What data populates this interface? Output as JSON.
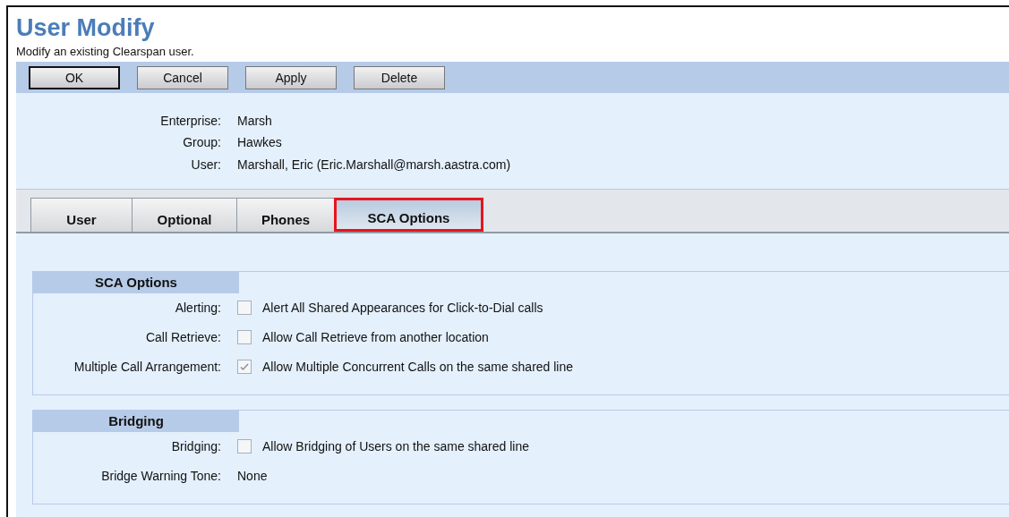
{
  "page": {
    "title": "User Modify",
    "subtitle": "Modify an existing Clearspan user."
  },
  "buttons": [
    {
      "label": "OK",
      "default": true
    },
    {
      "label": "Cancel",
      "default": false
    },
    {
      "label": "Apply",
      "default": false
    },
    {
      "label": "Delete",
      "default": false
    }
  ],
  "info": [
    {
      "label": "Enterprise:",
      "value": "Marsh"
    },
    {
      "label": "Group:",
      "value": "Hawkes"
    },
    {
      "label": "User:",
      "value": "Marshall, Eric (Eric.Marshall@marsh.aastra.com)"
    }
  ],
  "tabs": [
    {
      "label": "User",
      "selected": false
    },
    {
      "label": "Optional",
      "selected": false
    },
    {
      "label": "Phones",
      "selected": false
    },
    {
      "label": "SCA Options",
      "selected": true
    }
  ],
  "sections": [
    {
      "title": "SCA Options",
      "rows": [
        {
          "kind": "checkbox",
          "label": "Alerting:",
          "text": "Alert All Shared Appearances for Click-to-Dial calls",
          "checked": false
        },
        {
          "kind": "checkbox",
          "label": "Call Retrieve:",
          "text": "Allow Call Retrieve from another location",
          "checked": false
        },
        {
          "kind": "checkbox",
          "label": "Multiple Call Arrangement:",
          "text": "Allow Multiple Concurrent Calls on the same shared line",
          "checked": true
        }
      ]
    },
    {
      "title": "Bridging",
      "rows": [
        {
          "kind": "checkbox",
          "label": "Bridging:",
          "text": "Allow Bridging of Users on the same shared line",
          "checked": false
        },
        {
          "kind": "value",
          "label": "Bridge Warning Tone:",
          "text": "None"
        }
      ]
    }
  ]
}
